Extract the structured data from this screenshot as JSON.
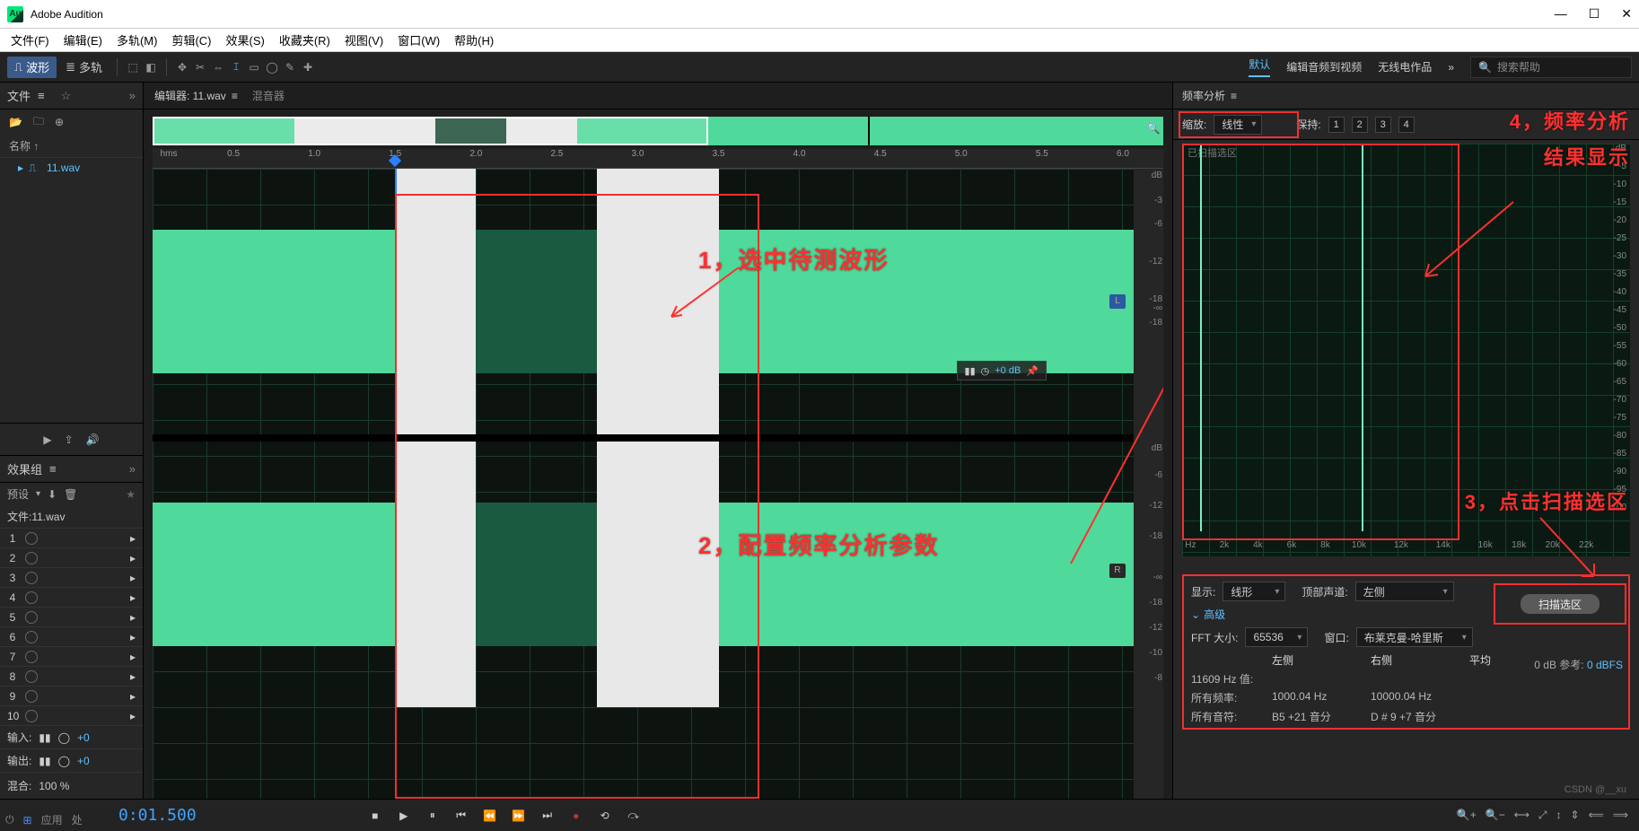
{
  "titlebar": {
    "app": "Adobe Audition"
  },
  "menu": {
    "file": "文件(F)",
    "edit": "编辑(E)",
    "multi": "多轨(M)",
    "clip": "剪辑(C)",
    "effect": "效果(S)",
    "fav": "收藏夹(R)",
    "view": "视图(V)",
    "window": "窗口(W)",
    "help": "帮助(H)"
  },
  "topbar": {
    "waveform": "波形",
    "multitrack": "多轨",
    "right_default": "默认",
    "right_tab1": "编辑音频到视频",
    "right_tab2": "无线电作品",
    "search_ph": "搜索帮助"
  },
  "files_panel": {
    "title": "文件",
    "name_hdr": "名称 ↑",
    "file1": "11.wav"
  },
  "fx_panel": {
    "title": "效果组",
    "preset": "预设",
    "file_label": "文件:11.wav",
    "input": "输入:",
    "output": "输出:",
    "plus0": "+0",
    "mix": "混合:",
    "mix_val": "100 %"
  },
  "editor": {
    "tab_editor": "编辑器: 11.wav",
    "tab_mixer": "混音器",
    "hms": "hms",
    "ticks": [
      "0.5",
      "1.0",
      "1.5",
      "2.0",
      "2.5",
      "3.0",
      "3.5",
      "4.0",
      "4.5",
      "5.0",
      "5.5",
      "6.0"
    ],
    "db_labels_top": [
      "dB",
      "-3",
      "-6",
      "-12",
      "-18",
      "-∞",
      "-18"
    ],
    "db_labels_bot": [
      "dB",
      "-6",
      "-12",
      "-18",
      "-∞",
      "-18",
      "-12",
      "-10",
      "-8"
    ],
    "vol": "+0 dB",
    "ch_L": "L",
    "ch_R": "R"
  },
  "bottom": {
    "apply": "应用",
    "proc": "处",
    "timecode": "0:01.500"
  },
  "freq": {
    "title": "频率分析",
    "zoom_label": "缩放:",
    "zoom_val": "线性",
    "hold_label": "保持:",
    "holds": [
      "1",
      "2",
      "3",
      "4"
    ],
    "scan_region_label": "已扫描选区",
    "db_scale": [
      "dB",
      "-5",
      "-10",
      "-15",
      "-20",
      "-25",
      "-30",
      "-35",
      "-40",
      "-45",
      "-50",
      "-55",
      "-60",
      "-65",
      "-70",
      "-75",
      "-80",
      "-85",
      "-90",
      "-95",
      "-100"
    ],
    "hz_scale": [
      "Hz",
      "2k",
      "4k",
      "6k",
      "8k",
      "10k",
      "12k",
      "14k",
      "16k",
      "18k",
      "20k",
      "22k"
    ],
    "display_label": "显示:",
    "display_val": "线形",
    "channel_label": "顶部声道:",
    "channel_val": "左侧",
    "scan_btn": "扫描选区",
    "adv": "高级",
    "fft_label": "FFT 大小:",
    "fft_val": "65536",
    "win_label": "窗口:",
    "win_val": "布莱克曼-哈里斯",
    "zero_ref_label": "0 dB 参考: ",
    "zero_ref_val": "0 dBFS",
    "hz_val_row": "11609 Hz 值:",
    "all_freq": "所有频率:",
    "all_note": "所有音符:",
    "col_left": "左侧",
    "col_right": "右侧",
    "col_avg": "平均",
    "f_left": "1000.04 Hz",
    "f_right": "10000.04 Hz",
    "n_left": "B5 +21 音分",
    "n_right": "D # 9 +7 音分"
  },
  "annotations": {
    "a1": "1，选中待测波形",
    "a2": "2，配置频率分析参数",
    "a3": "3，点击扫描选区",
    "a4a": "4，频率分析",
    "a4b": "结果显示"
  },
  "watermark": "CSDN @__xu"
}
